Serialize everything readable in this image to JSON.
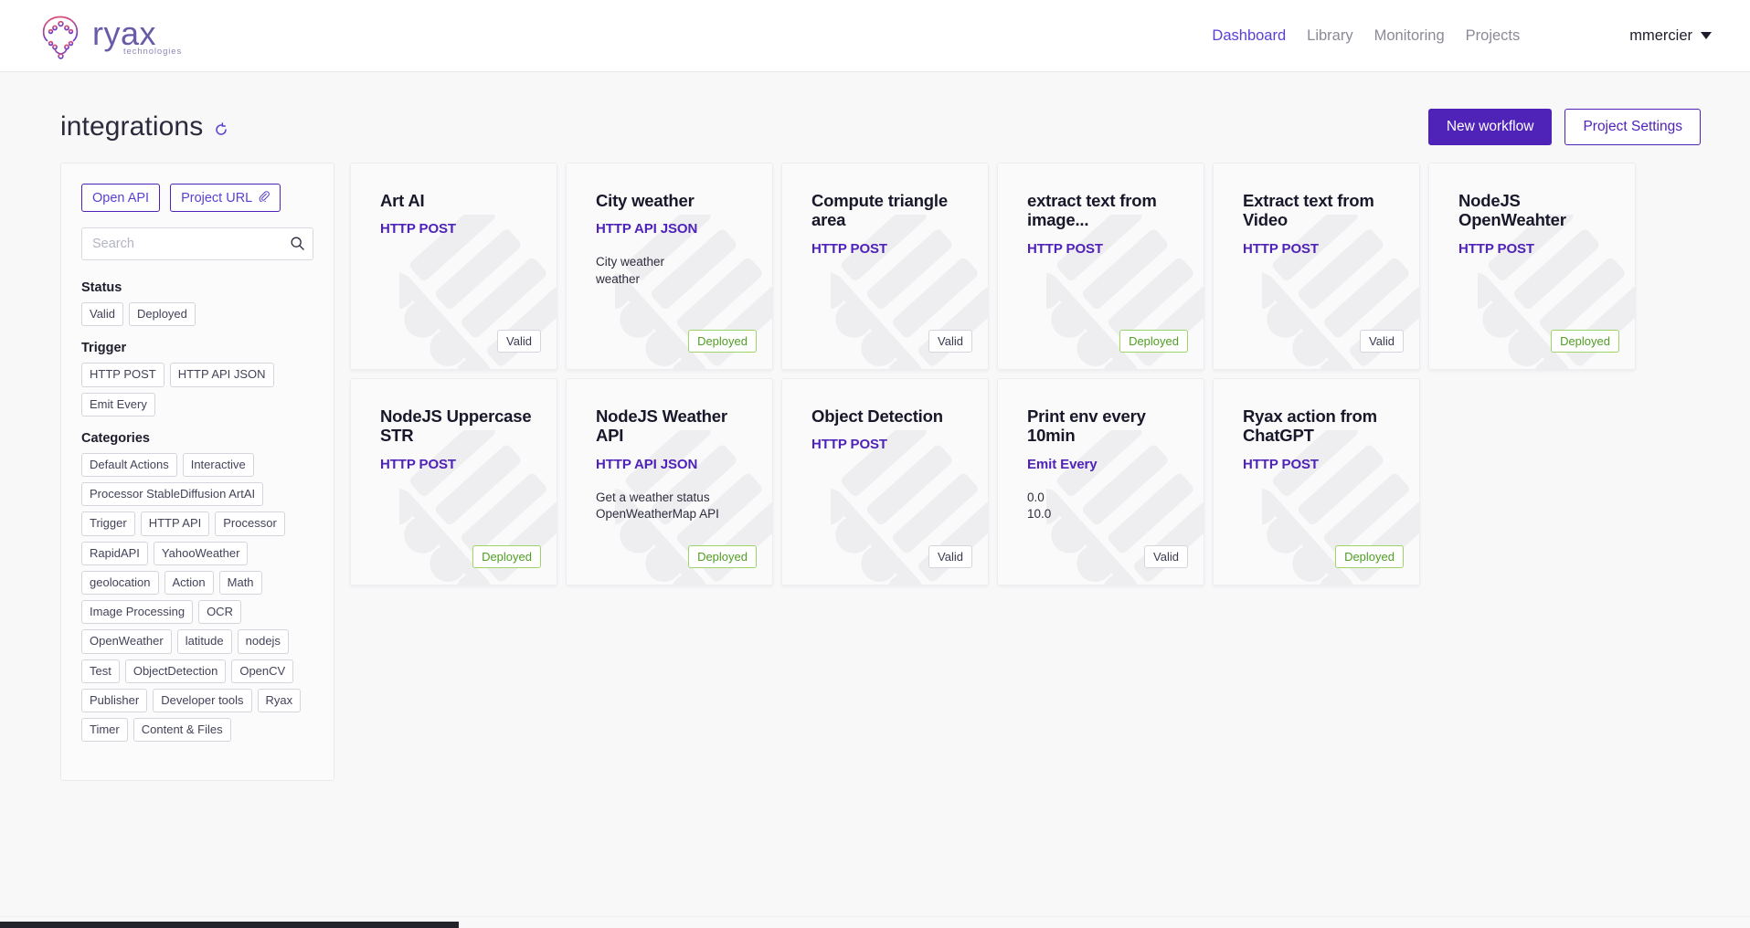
{
  "brand": {
    "word": "ryax",
    "tagline": "technologies",
    "logo_icon": "ryax-jellyfish-logo",
    "gradient_from": "#e8506e",
    "gradient_to": "#6d3fc4"
  },
  "nav": {
    "items": [
      {
        "label": "Dashboard",
        "active": true
      },
      {
        "label": "Library",
        "active": false
      },
      {
        "label": "Monitoring",
        "active": false
      },
      {
        "label": "Projects",
        "active": false
      }
    ],
    "user": "mmercier",
    "caret_icon": "chevron-down-icon"
  },
  "page": {
    "title": "integrations",
    "refresh_icon": "spinner-refresh-icon",
    "primary_button": "New workflow",
    "secondary_button": "Project Settings",
    "accent": "#4f22b8"
  },
  "sidebar": {
    "top_buttons": [
      {
        "label": "Open API",
        "icon": null
      },
      {
        "label": "Project URL",
        "icon": "paperclip-icon"
      }
    ],
    "search": {
      "value": "",
      "placeholder": "Search",
      "icon": "search-icon"
    },
    "groups": [
      {
        "heading": "Status",
        "chips": [
          "Valid",
          "Deployed"
        ]
      },
      {
        "heading": "Trigger",
        "chips": [
          "HTTP POST",
          "HTTP API JSON",
          "Emit Every"
        ]
      },
      {
        "heading": "Categories",
        "chips": [
          "Default Actions",
          "Interactive",
          "Processor StableDiffusion ArtAI",
          "Trigger",
          "HTTP API",
          "Processor",
          "RapidAPI",
          "YahooWeather",
          "geolocation",
          "Action",
          "Math",
          "Image Processing",
          "OCR",
          "OpenWeather",
          "latitude",
          "nodejs",
          "Test",
          "ObjectDetection",
          "OpenCV",
          "Publisher",
          "Developer tools",
          "Ryax",
          "Timer",
          "Content & Files"
        ]
      }
    ]
  },
  "cards": [
    {
      "title": "Art AI",
      "trigger": "HTTP POST",
      "description": "",
      "status": "Valid",
      "status_kind": "valid"
    },
    {
      "title": "City weather",
      "trigger": "HTTP API JSON",
      "description": "City weather\nweather",
      "status": "Deployed",
      "status_kind": "deployed"
    },
    {
      "title": "Compute triangle area",
      "trigger": "HTTP POST",
      "description": "",
      "status": "Valid",
      "status_kind": "valid"
    },
    {
      "title": "extract text from image...",
      "trigger": "HTTP POST",
      "description": "",
      "status": "Deployed",
      "status_kind": "deployed"
    },
    {
      "title": "Extract text from Video",
      "trigger": "HTTP POST",
      "description": "",
      "status": "Valid",
      "status_kind": "valid"
    },
    {
      "title": "NodeJS OpenWeahter",
      "trigger": "HTTP POST",
      "description": "",
      "status": "Deployed",
      "status_kind": "deployed"
    },
    {
      "title": "NodeJS Uppercase STR",
      "trigger": "HTTP POST",
      "description": "",
      "status": "Deployed",
      "status_kind": "deployed"
    },
    {
      "title": "NodeJS Weather API",
      "trigger": "HTTP API JSON",
      "description": "Get a weather status\nOpenWeatherMap API",
      "status": "Deployed",
      "status_kind": "deployed"
    },
    {
      "title": "Object Detection",
      "trigger": "HTTP POST",
      "description": "",
      "status": "Valid",
      "status_kind": "valid"
    },
    {
      "title": "Print env every 10min",
      "trigger": "Emit Every",
      "description": "0.0\n10.0",
      "status": "Valid",
      "status_kind": "valid"
    },
    {
      "title": "Ryax action from ChatGPT",
      "trigger": "HTTP POST",
      "description": "",
      "status": "Deployed",
      "status_kind": "deployed"
    }
  ],
  "scrollbar": {
    "orientation": "horizontal",
    "thumb_position": "left"
  }
}
